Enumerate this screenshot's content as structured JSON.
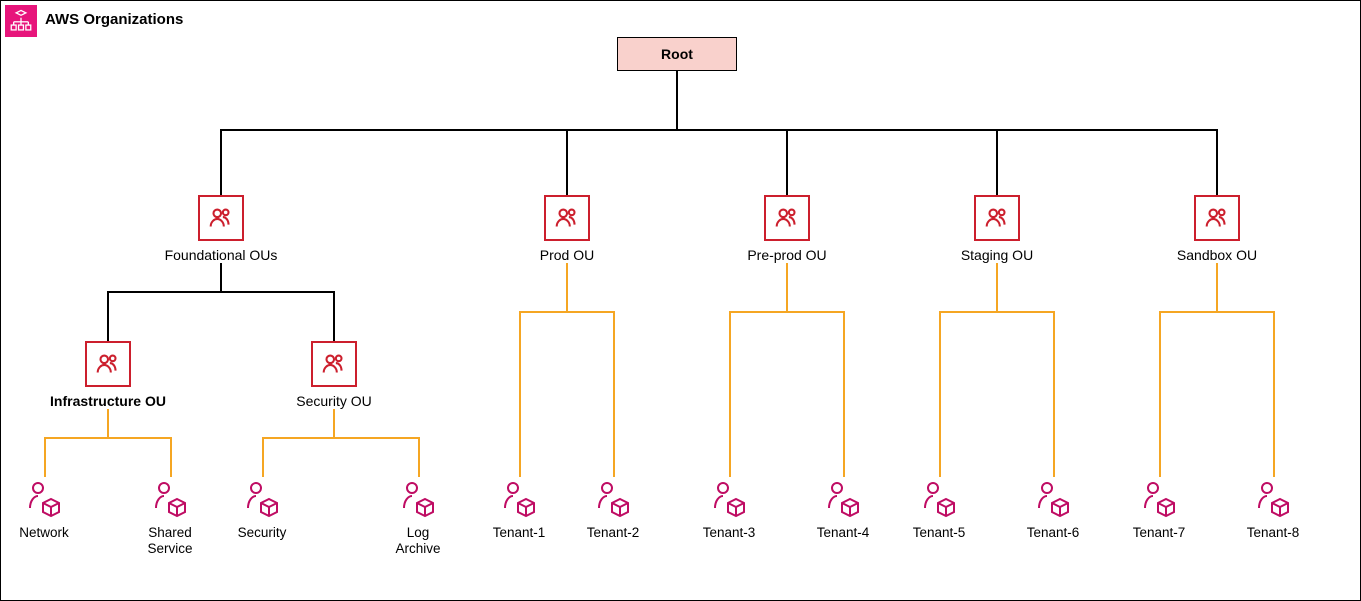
{
  "header": {
    "title": "AWS Organizations",
    "icon": "aws-organizations-icon"
  },
  "root": {
    "label": "Root"
  },
  "ous_level1": {
    "foundational": {
      "label": "Foundational OUs"
    },
    "prod": {
      "label": "Prod OU"
    },
    "preprod": {
      "label": "Pre-prod OU"
    },
    "staging": {
      "label": "Staging OU"
    },
    "sandbox": {
      "label": "Sandbox OU"
    }
  },
  "ous_level2": {
    "infrastructure": {
      "label": "Infrastructure OU",
      "bold": true
    },
    "security": {
      "label": "Security OU"
    }
  },
  "accounts": {
    "network": {
      "label": "Network"
    },
    "shared_service": {
      "label": "Shared\nService"
    },
    "security": {
      "label": "Security"
    },
    "log_archive": {
      "label": "Log\nArchive"
    },
    "tenant1": {
      "label": "Tenant-1"
    },
    "tenant2": {
      "label": "Tenant-2"
    },
    "tenant3": {
      "label": "Tenant-3"
    },
    "tenant4": {
      "label": "Tenant-4"
    },
    "tenant5": {
      "label": "Tenant-5"
    },
    "tenant6": {
      "label": "Tenant-6"
    },
    "tenant7": {
      "label": "Tenant-7"
    },
    "tenant8": {
      "label": "Tenant-8"
    }
  }
}
